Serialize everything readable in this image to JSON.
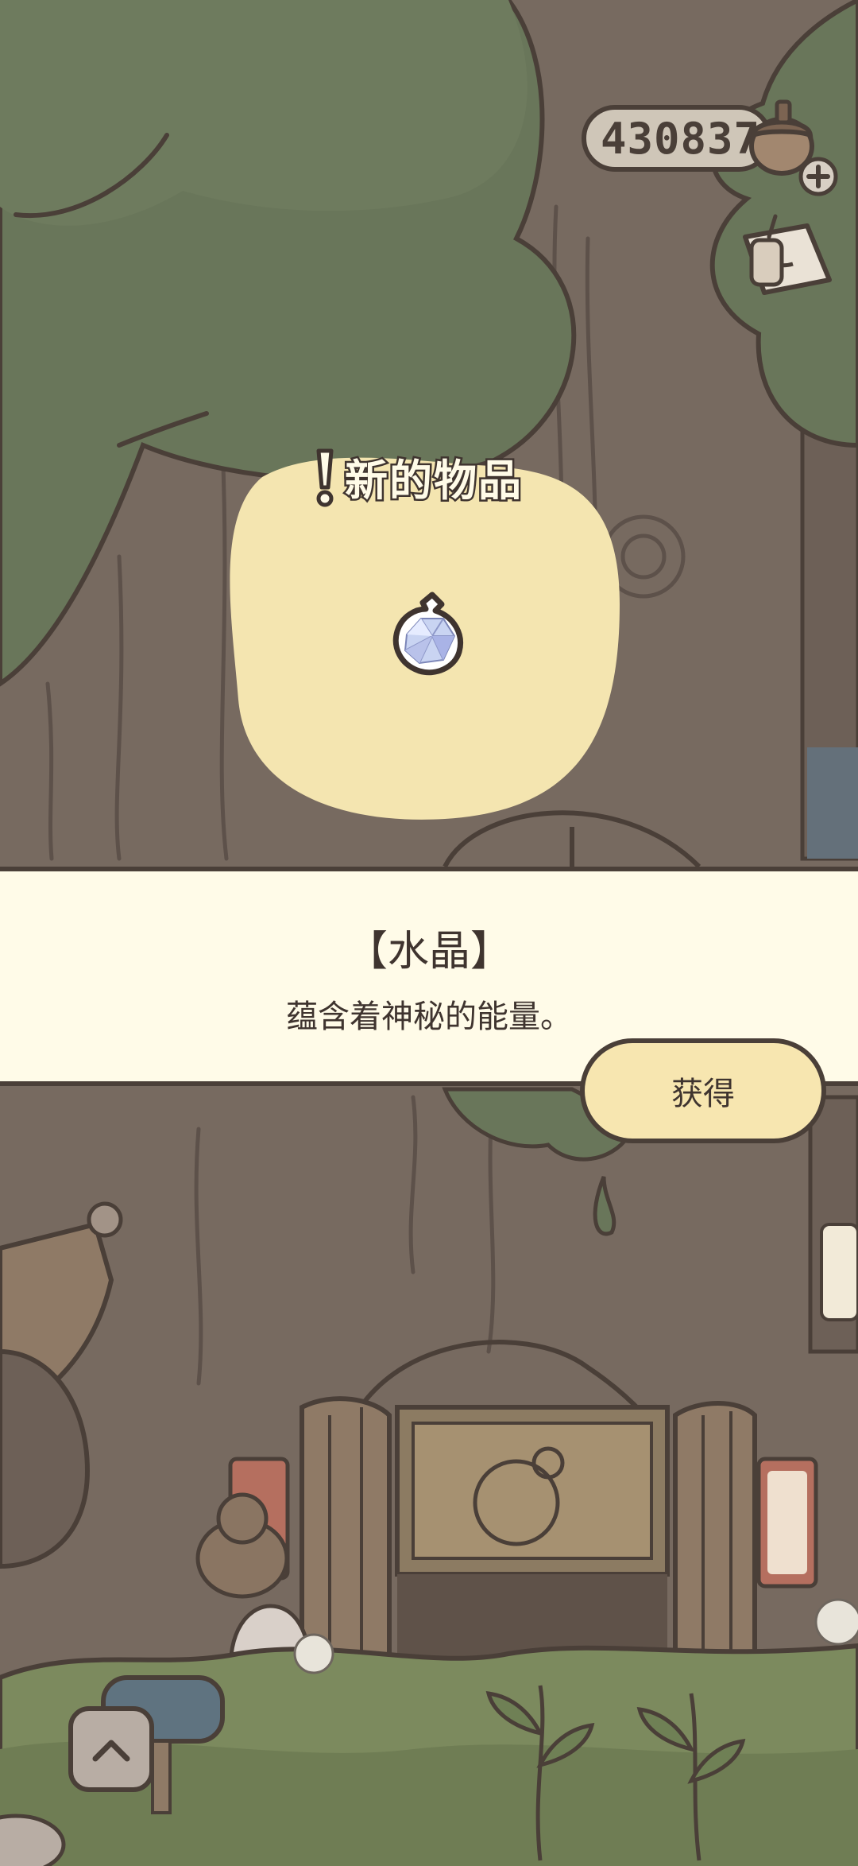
{
  "hud": {
    "acorn_count": "430837",
    "acorn_icon": "acorn-icon",
    "add_icon": "plus-icon",
    "letter_icon": "letter-icon"
  },
  "new_item": {
    "label": "新的物品",
    "icon": "crystal-icon"
  },
  "item_info": {
    "name": "【水晶】",
    "description": "蕴含着神秘的能量。"
  },
  "actions": {
    "obtain_label": "获得",
    "collapse_icon": "chevron-up-icon"
  },
  "colors": {
    "outline": "#4a3f38",
    "banner_bg": "#fffbe8",
    "highlight": "#f4e5b0",
    "button_bg": "#f7e6b0",
    "foliage": "#6c7a5c",
    "trunk": "#7a6b61"
  }
}
